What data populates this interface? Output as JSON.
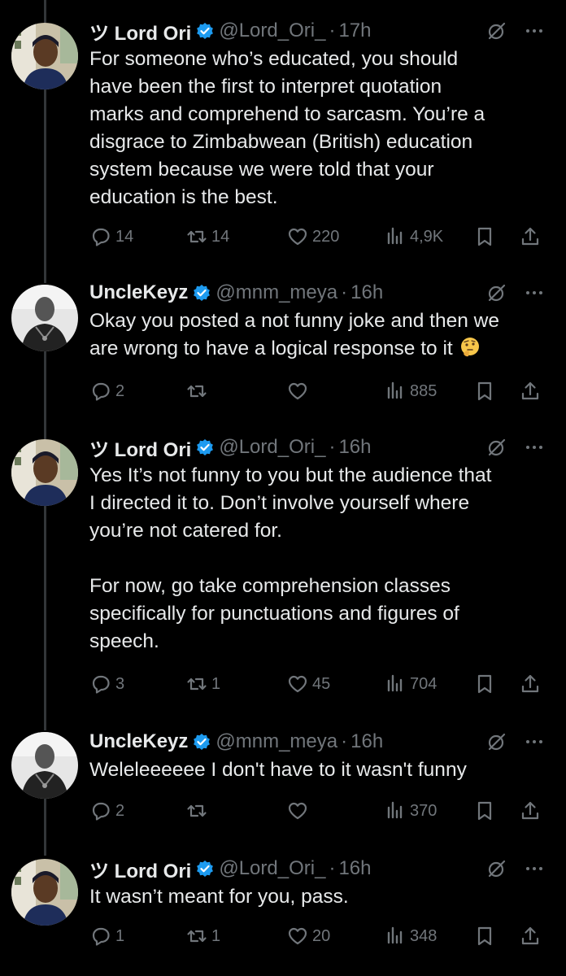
{
  "tweets": [
    {
      "author": "ツ Lord Ori",
      "handle": "@Lord_Ori_",
      "time": "17h",
      "text": "For someone who’s educated, you should\nhave been the first to interpret quotation\nmarks and comprehend to sarcasm. You’re a\ndisgrace to Zimbabwean (British) education\nsystem because we were told that your\neducation is the best.",
      "replies": "14",
      "reposts": "14",
      "likes": "220",
      "views": "4,9K"
    },
    {
      "author": "UncleKeyz",
      "handle": "@mnm_meya",
      "time": "16h",
      "text": "Okay you posted a not funny joke and then we\nare wrong to have a logical response to it ",
      "replies": "2",
      "reposts": "",
      "likes": "",
      "views": "885"
    },
    {
      "author": "ツ Lord Ori",
      "handle": "@Lord_Ori_",
      "time": "16h",
      "text": "Yes It’s not funny to you but the audience that\nI directed it to. Don’t involve yourself where\nyou’re not catered for.\n\nFor now, go take comprehension classes\nspecifically for punctuations and figures of\nspeech.",
      "replies": "3",
      "reposts": "1",
      "likes": "45",
      "views": "704"
    },
    {
      "author": "UncleKeyz",
      "handle": "@mnm_meya",
      "time": "16h",
      "text": "Weleleeeeee I don't have to it wasn't funny",
      "replies": "2",
      "reposts": "",
      "likes": "",
      "views": "370"
    },
    {
      "author": "ツ Lord Ori",
      "handle": "@Lord_Ori_",
      "time": "16h",
      "text": "It wasn’t meant for you, pass.",
      "replies": "1",
      "reposts": "1",
      "likes": "20",
      "views": "348"
    }
  ],
  "dot": "·",
  "icons": {
    "verified": "verified-badge-icon",
    "grok": "grok-icon",
    "more": "more-icon",
    "reply": "reply-icon",
    "repost": "repost-icon",
    "like": "like-icon",
    "views": "views-icon",
    "bookmark": "bookmark-icon",
    "share": "share-icon",
    "emoji": "thinking-face-emoji"
  },
  "colors": {
    "background": "#000000",
    "text": "#e7e9ea",
    "secondary": "#71767b",
    "verified": "#1d9bf0",
    "thread_line": "#333639"
  }
}
